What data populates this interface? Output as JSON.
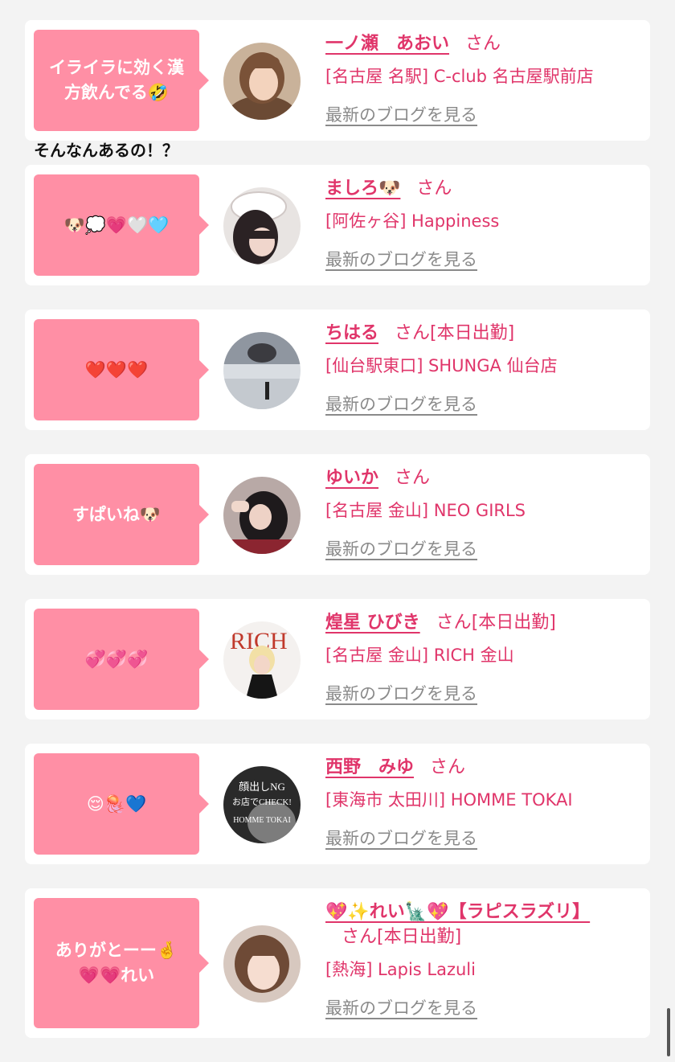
{
  "standalone_comment": "そんなんあるの！？",
  "entries": [
    {
      "bubble": "イライラに効く漢方飲んでる🤣",
      "name": "一ノ瀬　あおい",
      "suffix": "さん",
      "status": "",
      "shop": "[名古屋 名駅] C-club 名古屋駅前店",
      "blog_link": "最新のブログを見る"
    },
    {
      "bubble": "🐶💭💗🤍🩵",
      "name": "ましろ🐶",
      "suffix": "さん",
      "status": "",
      "shop": "[阿佐ヶ谷] Happiness",
      "blog_link": "最新のブログを見る"
    },
    {
      "bubble": "❤️❤️❤️",
      "name": "ちはる",
      "suffix": "さん",
      "status": "[本日出勤]",
      "shop": "[仙台駅東口] SHUNGA 仙台店",
      "blog_link": "最新のブログを見る"
    },
    {
      "bubble": "すぱいね🐶",
      "name": "ゆいか",
      "suffix": "さん",
      "status": "",
      "shop": "[名古屋 金山] NEO GIRLS",
      "blog_link": "最新のブログを見る"
    },
    {
      "bubble": "💞💞💞",
      "name": "煌星 ひびき",
      "suffix": "さん",
      "status": "[本日出勤]",
      "shop": "[名古屋 金山] RICH 金山",
      "blog_link": "最新のブログを見る"
    },
    {
      "bubble": "😌🪼💙",
      "name": "西野　みゆ",
      "suffix": "さん",
      "status": "",
      "shop": "[東海市 太田川] HOMME TOKAI",
      "blog_link": "最新のブログを見る"
    },
    {
      "bubble": "ありがとーー🤞\n💗💗れい",
      "name": "💖✨れい🗽💖【ラピスラズリ】",
      "suffix": "さん",
      "status": "[本日出勤]",
      "shop": "[熱海] Lapis Lazuli",
      "blog_link": "最新のブログを見る"
    }
  ],
  "avatar_overlays": {
    "homme": "顔出しNG\nお店でCHECK!\nHOMME TOKAI",
    "rich": "RICH"
  },
  "colors": {
    "accent": "#e0356a",
    "bubble": "#ff8fa5",
    "background": "#f3f3f3",
    "card": "#ffffff",
    "link_grey": "#8a8a8a"
  }
}
